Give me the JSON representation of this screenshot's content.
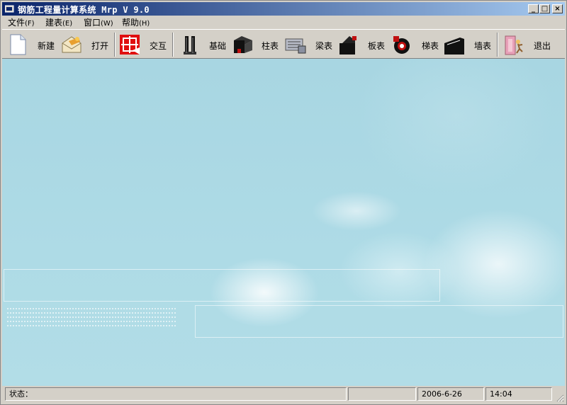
{
  "window": {
    "title": "钢筋工程量计算系统 Mrp V 9.0",
    "controls": {
      "minimize": "_",
      "maximize": "□",
      "close": "×"
    }
  },
  "menu": [
    {
      "label": "文件",
      "accel": "(F)"
    },
    {
      "label": "建表",
      "accel": "(E)"
    },
    {
      "label": "窗口",
      "accel": "(W)"
    },
    {
      "label": "帮助",
      "accel": "(H)"
    }
  ],
  "toolbar": [
    {
      "label": "新建",
      "icon": "new-document-icon"
    },
    {
      "label": "打开",
      "icon": "open-envelope-icon"
    },
    {
      "label": "交互",
      "icon": "interact-grid-icon"
    },
    {
      "label": "基础",
      "icon": "foundation-icon"
    },
    {
      "label": "柱表",
      "icon": "column-table-icon"
    },
    {
      "label": "梁表",
      "icon": "beam-table-icon"
    },
    {
      "label": "板表",
      "icon": "slab-table-icon"
    },
    {
      "label": "梯表",
      "icon": "stair-table-icon"
    },
    {
      "label": "墙表",
      "icon": "wall-table-icon"
    },
    {
      "label": "退出",
      "icon": "exit-icon"
    }
  ],
  "statusbar": {
    "status_label": "状态：",
    "status_value": "",
    "date": "2006-6-26",
    "time": "14:04"
  },
  "colors": {
    "titlebar_start": "#0a246a",
    "titlebar_end": "#a6caf0",
    "chrome": "#d4d0c8",
    "background": "#aedbe6"
  }
}
